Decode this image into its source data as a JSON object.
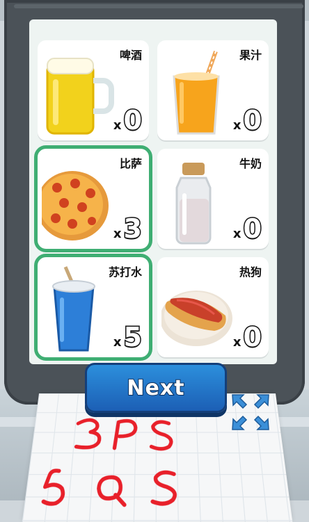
{
  "menu": {
    "items": [
      {
        "id": "beer",
        "label": "啤酒",
        "count": "0",
        "selected": false
      },
      {
        "id": "juice",
        "label": "果汁",
        "count": "0",
        "selected": false
      },
      {
        "id": "pizza",
        "label": "比萨",
        "count": "3",
        "selected": true
      },
      {
        "id": "milk",
        "label": "牛奶",
        "count": "0",
        "selected": false
      },
      {
        "id": "soda",
        "label": "苏打水",
        "count": "5",
        "selected": true
      },
      {
        "id": "hotdog",
        "label": "热狗",
        "count": "0",
        "selected": false
      }
    ],
    "multiplier_symbol": "x"
  },
  "next_button": {
    "label": "Next"
  },
  "note": {
    "lines": [
      "3PS",
      "5QS"
    ],
    "ink_color": "#e8202a"
  },
  "colors": {
    "selected_outline": "#3fae73",
    "button": "#1f6fc6"
  },
  "icons": {
    "expand": "expand-arrows-icon"
  }
}
